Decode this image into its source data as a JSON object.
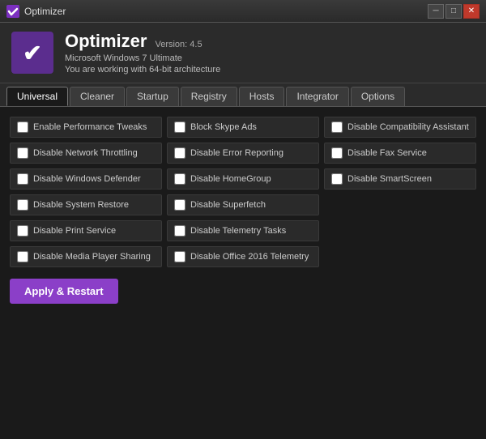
{
  "titleBar": {
    "title": "Optimizer",
    "controls": {
      "minimize": "─",
      "maximize": "□",
      "close": "✕"
    }
  },
  "header": {
    "appName": "Optimizer",
    "version": "Version: 4.5",
    "systemInfo1": "Microsoft Windows 7 Ultimate",
    "systemInfo2": "You are working with 64-bit architecture"
  },
  "tabs": [
    {
      "label": "Universal",
      "active": true
    },
    {
      "label": "Cleaner",
      "active": false
    },
    {
      "label": "Startup",
      "active": false
    },
    {
      "label": "Registry",
      "active": false
    },
    {
      "label": "Hosts",
      "active": false
    },
    {
      "label": "Integrator",
      "active": false
    },
    {
      "label": "Options",
      "active": false
    }
  ],
  "checkboxItems": [
    {
      "id": "col1_r1",
      "label": "Enable Performance Tweaks"
    },
    {
      "id": "col2_r1",
      "label": "Block Skype Ads"
    },
    {
      "id": "col3_r1",
      "label": "Disable Compatibility Assistant"
    },
    {
      "id": "col1_r2",
      "label": "Disable Network Throttling"
    },
    {
      "id": "col2_r2",
      "label": "Disable Error Reporting"
    },
    {
      "id": "col3_r2",
      "label": "Disable Fax Service"
    },
    {
      "id": "col1_r3",
      "label": "Disable Windows Defender"
    },
    {
      "id": "col2_r3",
      "label": "Disable HomeGroup"
    },
    {
      "id": "col3_r3",
      "label": "Disable SmartScreen"
    },
    {
      "id": "col1_r4",
      "label": "Disable System Restore"
    },
    {
      "id": "col2_r4",
      "label": "Disable Superfetch"
    },
    {
      "id": "col3_r4_empty",
      "label": ""
    },
    {
      "id": "col1_r5",
      "label": "Disable Print Service"
    },
    {
      "id": "col2_r5",
      "label": "Disable Telemetry Tasks"
    },
    {
      "id": "col3_r5_empty",
      "label": ""
    },
    {
      "id": "col1_r6",
      "label": "Disable Media Player Sharing"
    },
    {
      "id": "col2_r6",
      "label": "Disable Office 2016 Telemetry"
    },
    {
      "id": "col3_r6_empty",
      "label": ""
    }
  ],
  "applyButton": {
    "label": "Apply & Restart"
  }
}
